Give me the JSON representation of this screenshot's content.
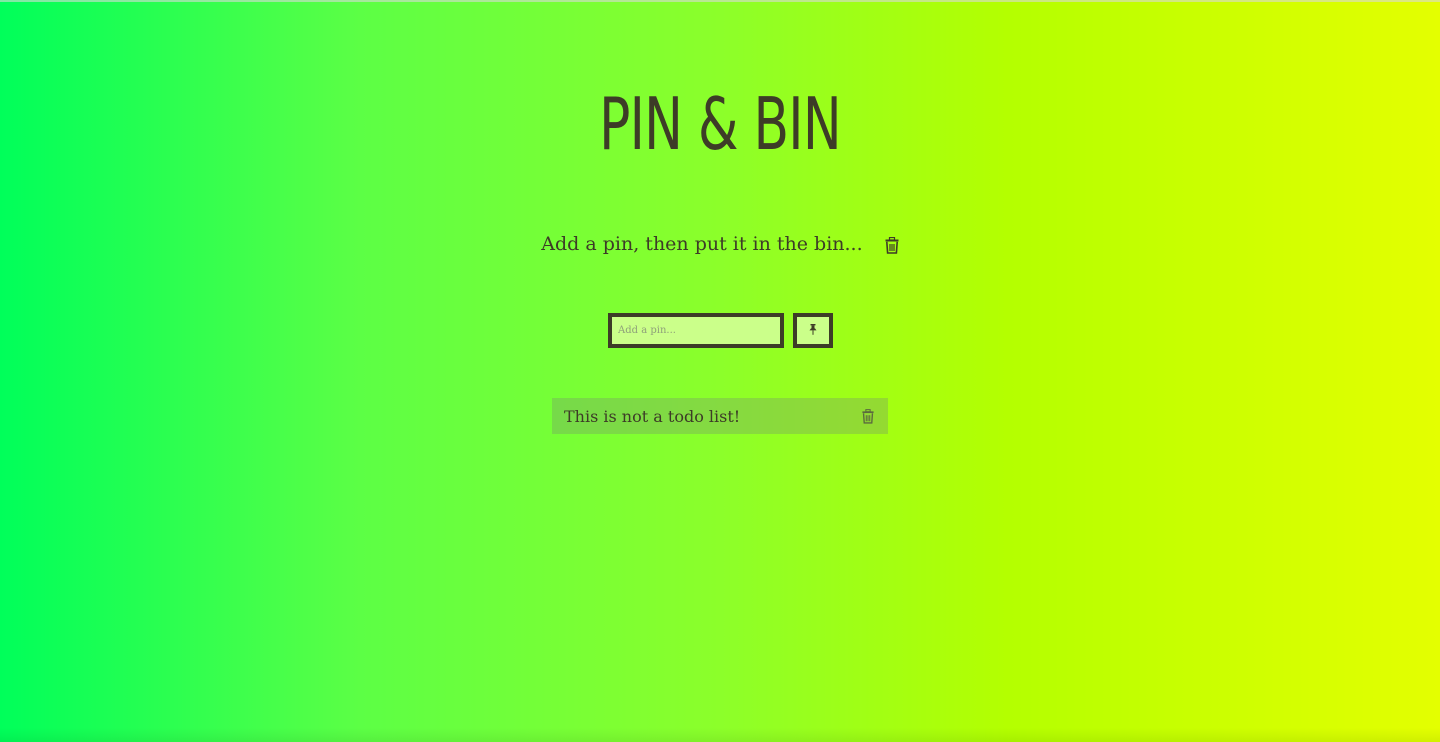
{
  "header": {
    "title": "PIN & BIN",
    "subtitle": "Add a pin, then put it in the bin..."
  },
  "form": {
    "placeholder": "Add a pin...",
    "value": "",
    "submit_icon": "pushpin-icon"
  },
  "pins": [
    {
      "text": "This is not a todo list!",
      "delete_icon": "trash-icon"
    }
  ],
  "colors": {
    "text": "#3d3c27",
    "gradient_start": "#00ff5a",
    "gradient_end": "#e4ff00",
    "input_bg": "#cbff8a"
  }
}
